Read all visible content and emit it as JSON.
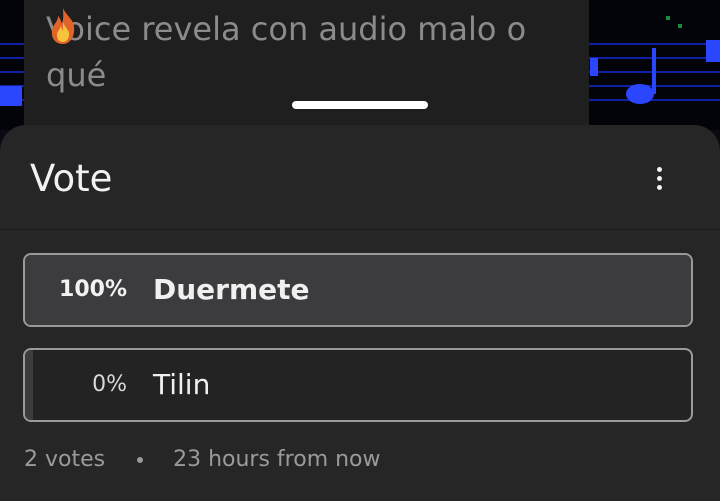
{
  "post": {
    "title": "Voice revela con audio malo o qué",
    "emoji": "fire-icon"
  },
  "sheet": {
    "title": "Vote",
    "menu_icon": "more-vertical-icon"
  },
  "poll": {
    "options": [
      {
        "percent_label": "100%",
        "label": "Duermete",
        "fraction": 1.0,
        "winner": true
      },
      {
        "percent_label": "0%",
        "label": "Tilin",
        "fraction": 0.0,
        "winner": false
      }
    ],
    "votes": "2 votes",
    "time_remaining": "23 hours from now"
  },
  "colors": {
    "sheet_bg": "#262626",
    "bar_fill": "#3c3c3f",
    "option_border": "#9a9a9a",
    "muted_text": "#9a9a9a",
    "background_accent_blue": "#1a2cff"
  }
}
